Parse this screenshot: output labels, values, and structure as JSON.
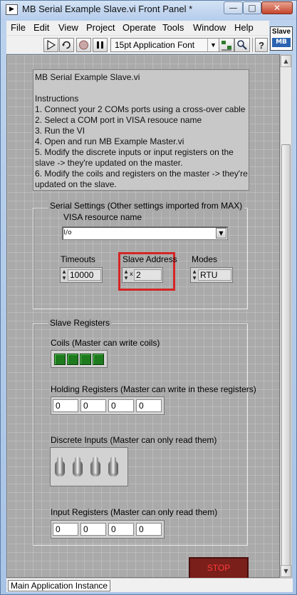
{
  "window": {
    "title": "MB Serial Example Slave.vi Front Panel *",
    "minimize": "—",
    "maximize": "□",
    "close": "✕",
    "app_icon_glyph": "▶"
  },
  "menu": [
    "File",
    "Edit",
    "View",
    "Project",
    "Operate",
    "Tools",
    "Window",
    "Help"
  ],
  "toolbar": {
    "font": "15pt Application Font"
  },
  "vi_icon": {
    "top": "Slave",
    "bottom": "MB"
  },
  "instructions": [
    "MB Serial Example Slave.vi",
    "",
    "Instructions",
    "1. Connect your 2 COMs ports using a cross-over cable",
    "2. Select a COM port in VISA resouce name",
    "3. Run the VI",
    "4. Open and run MB Example Master.vi",
    "5. Modify the discrete inputs or input registers on the",
    "slave -> they're updated on the master.",
    "6. Modify the coils and registers on the master -> they're",
    "updated on the slave."
  ],
  "serial_settings": {
    "title": "Serial Settings (Other settings imported from MAX)",
    "visa_label": "VISA resource name",
    "visa_prefix": "I/o",
    "visa_value": "",
    "timeouts_label": "Timeouts",
    "timeouts_value": "10000",
    "slave_address_label": "Slave Address",
    "slave_address_radix": "x",
    "slave_address_value": "2",
    "modes_label": "Modes",
    "modes_value": "RTU"
  },
  "slave_registers": {
    "title": "Slave Registers",
    "coils_label": "Coils (Master can write coils)",
    "coils": [
      true,
      true,
      true,
      true
    ],
    "holding_label": "Holding Registers (Master can write in these registers)",
    "holding": [
      "0",
      "0",
      "0",
      "0"
    ],
    "discrete_label": "Discrete Inputs (Master can only read them)",
    "discrete": [
      false,
      false,
      false,
      false
    ],
    "input_label": "Input Registers (Master can only read them)",
    "input": [
      "0",
      "0",
      "0",
      "0"
    ]
  },
  "stop_label": "STOP",
  "status": "Main Application Instance",
  "colors": {
    "highlight": "#d52525",
    "led_on": "#1d7a1d",
    "stop_text": "#ff3b3b"
  }
}
